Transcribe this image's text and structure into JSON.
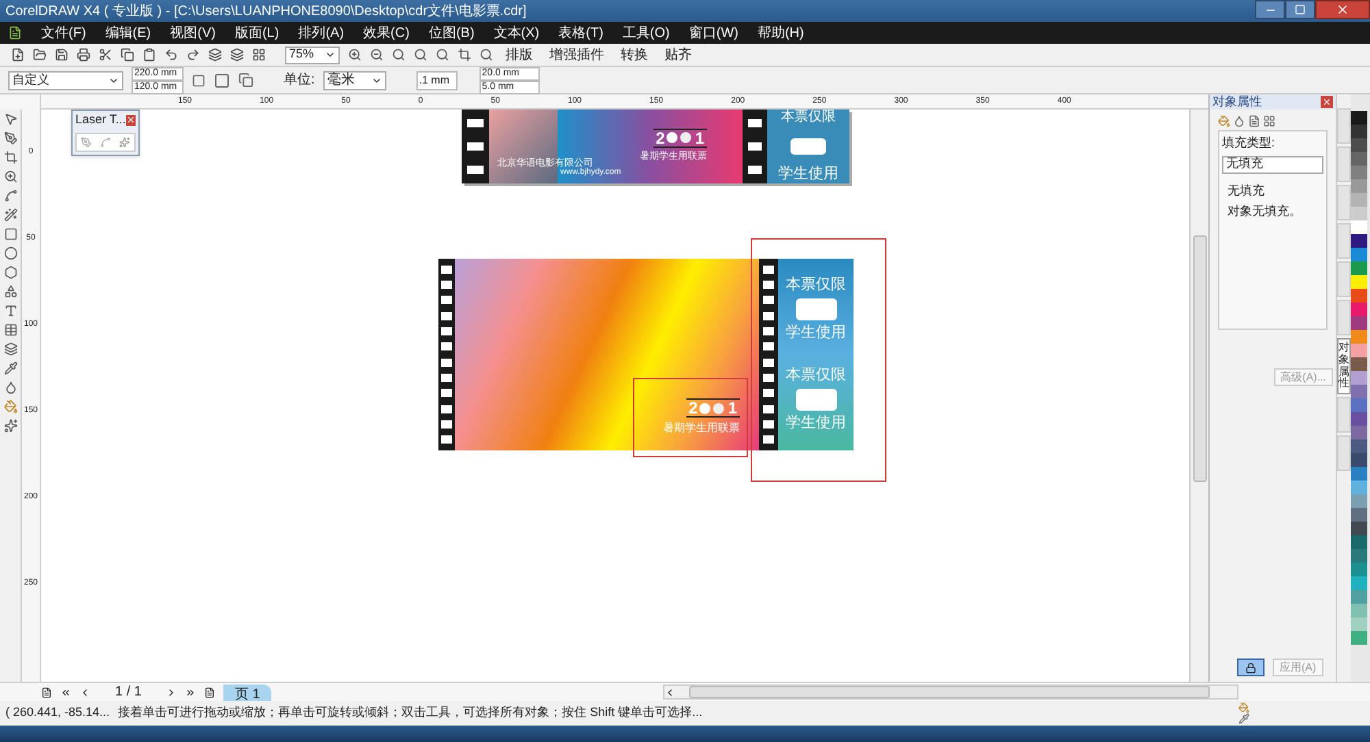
{
  "window": {
    "title": "CorelDRAW X4 ( 专业版 ) - [C:\\Users\\LUANPHONE8090\\Desktop\\cdr文件\\电影票.cdr]"
  },
  "menu": [
    {
      "label": "文件(F)"
    },
    {
      "label": "编辑(E)"
    },
    {
      "label": "视图(V)"
    },
    {
      "label": "版面(L)"
    },
    {
      "label": "排列(A)"
    },
    {
      "label": "效果(C)"
    },
    {
      "label": "位图(B)"
    },
    {
      "label": "文本(X)"
    },
    {
      "label": "表格(T)"
    },
    {
      "label": "工具(O)"
    },
    {
      "label": "窗口(W)"
    },
    {
      "label": "帮助(H)"
    }
  ],
  "toolbar": {
    "zoom": "75%",
    "buttons": [
      "排版",
      "增强插件",
      "转换",
      "贴齐"
    ]
  },
  "property_bar": {
    "preset": "自定义",
    "width": "220.0 mm",
    "height": "120.0 mm",
    "units_label": "单位:",
    "units": "毫米",
    "nudge": ".1 mm",
    "dup_x": "20.0 mm",
    "dup_y": "5.0 mm"
  },
  "rulers": {
    "horizontal": [
      "150",
      "100",
      "50",
      "0",
      "50",
      "100",
      "150",
      "200",
      "250",
      "300",
      "350",
      "400"
    ],
    "vertical": [
      "0",
      "50",
      "100",
      "150",
      "200",
      "250"
    ]
  },
  "floating_panel": {
    "title": "Laser T..."
  },
  "top_ticket": {
    "company": "北京华语电影有限公司",
    "url": "www.bjhydy.com",
    "logo": [
      "2",
      "1"
    ],
    "subtitle": "暑期学生用联票",
    "stub": [
      "本票仅限",
      "学生使用"
    ]
  },
  "bottom_ticket": {
    "logo": [
      "2",
      "1"
    ],
    "subtitle": "暑期学生用联票",
    "stubs": [
      [
        "本票仅限",
        "学生使用"
      ],
      [
        "本票仅限",
        "学生使用"
      ]
    ]
  },
  "docker": {
    "title": "对象属性",
    "fill_label": "填充类型:",
    "fill_type": "无填充",
    "info_title": "无填充",
    "info_text": "对象无填充。",
    "advanced_button": "高级(A)...",
    "apply_button": "应用(A)"
  },
  "docker_tabs": [
    {
      "selected": false
    },
    {
      "selected": false
    },
    {
      "selected": false
    },
    {
      "selected": false
    },
    {
      "selected": false
    },
    {
      "selected": false
    },
    {
      "label": "对象属性",
      "selected": true
    },
    {
      "selected": false
    },
    {
      "selected": false
    }
  ],
  "palette": [
    {
      "color": "#1a1a1a"
    },
    {
      "color": "#333333"
    },
    {
      "color": "#4d4d4d"
    },
    {
      "color": "#666666"
    },
    {
      "color": "#808080"
    },
    {
      "color": "#999999"
    },
    {
      "color": "#b3b3b3"
    },
    {
      "color": "#cccccc"
    },
    {
      "color": "#ffffff"
    },
    {
      "color": "#2e1a80"
    },
    {
      "color": "#1a8ad4"
    },
    {
      "color": "#1a9a4a"
    },
    {
      "color": "#ffee00"
    },
    {
      "color": "#e84a1a"
    },
    {
      "color": "#e81a6a"
    },
    {
      "color": "#a03a80"
    },
    {
      "color": "#f08a1a"
    },
    {
      "color": "#f4a0a0"
    },
    {
      "color": "#7a5a4a"
    },
    {
      "color": "#b0a0d0"
    },
    {
      "color": "#8070b0"
    },
    {
      "color": "#5a70c0"
    },
    {
      "color": "#6a50a0"
    },
    {
      "color": "#7a6aa0"
    },
    {
      "color": "#4a5a80"
    },
    {
      "color": "#3a4a6a"
    },
    {
      "color": "#2a80c0"
    },
    {
      "color": "#60b0e0"
    },
    {
      "color": "#7aa0b0"
    },
    {
      "color": "#607080"
    },
    {
      "color": "#404a50"
    },
    {
      "color": "#1a6a6a"
    },
    {
      "color": "#2a7a7a"
    },
    {
      "color": "#1a9090"
    },
    {
      "color": "#20b0c0"
    },
    {
      "color": "#50a0a0"
    },
    {
      "color": "#80c0b0"
    },
    {
      "color": "#a0d0c0"
    },
    {
      "color": "#40b080"
    }
  ],
  "page_nav": {
    "counter": "1 / 1",
    "tabs": [
      {
        "label": "页 1",
        "selected": true
      }
    ]
  },
  "status_bar": {
    "coords": "( 260.441, -85.14...",
    "hint": "接着单击可进行拖动或缩放；再单击可旋转或倾斜；双击工具，可选择所有对象；按住 Shift 键单击可选择..."
  }
}
